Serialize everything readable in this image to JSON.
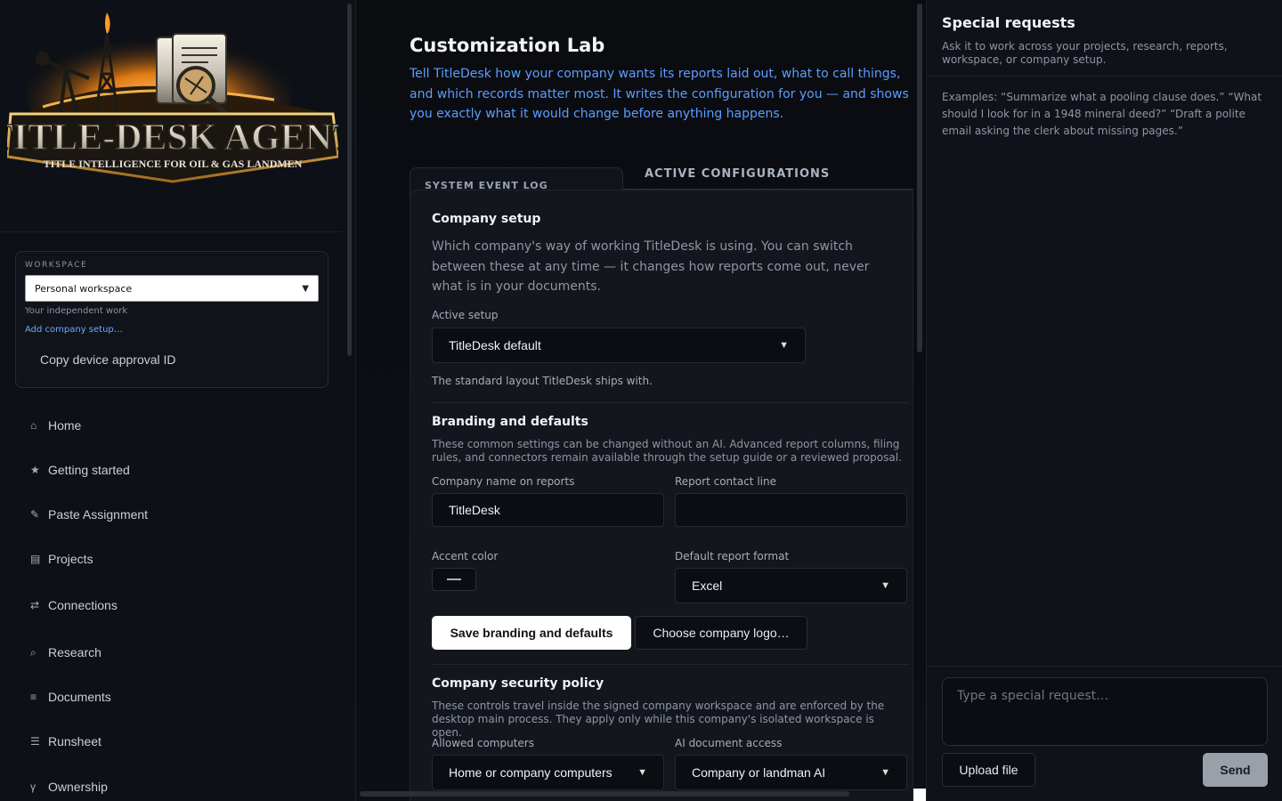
{
  "logo": {
    "title": "TITLE-DESK AGENT",
    "tagline": "TITLE INTELLIGENCE FOR OIL & GAS LANDMEN"
  },
  "workspace": {
    "label": "WORKSPACE",
    "selected": "Personal workspace",
    "subtext": "Your independent work",
    "add_link": "Add company setup…",
    "copy_button": "Copy device approval ID"
  },
  "nav": [
    {
      "label": "Home",
      "icon": "home-icon",
      "glyph": "⌂"
    },
    {
      "label": "Getting started",
      "icon": "star-icon",
      "glyph": "★"
    },
    {
      "label": "Paste Assignment",
      "icon": "pencil-icon",
      "glyph": "✎"
    },
    {
      "label": "Projects",
      "icon": "projects-icon",
      "glyph": "▤"
    },
    {
      "label": "Connections",
      "icon": "arrows-icon",
      "glyph": "⇄"
    },
    {
      "label": "Research",
      "icon": "search-icon",
      "glyph": "⌕"
    },
    {
      "label": "Documents",
      "icon": "documents-icon",
      "glyph": "≡"
    },
    {
      "label": "Runsheet",
      "icon": "list-icon",
      "glyph": "☰"
    },
    {
      "label": "Ownership",
      "icon": "branch-icon",
      "glyph": "γ"
    }
  ],
  "main": {
    "title": "Customization Lab",
    "description": "Tell TitleDesk how your company wants its reports laid out, what to call things, and which records matter most. It writes the configuration for you — and shows you exactly what it would change before anything happens.",
    "tabs": {
      "log": "SYSTEM EVENT LOG",
      "active": "ACTIVE CONFIGURATIONS"
    },
    "company_setup": {
      "title": "Company setup",
      "description": "Which company's way of working TitleDesk is using. You can switch between these at any time — it changes how reports come out, never what is in your documents.",
      "active_label": "Active setup",
      "active_value": "TitleDesk default",
      "active_note": "The standard layout TitleDesk ships with."
    },
    "branding": {
      "title": "Branding and defaults",
      "description": "These common settings can be changed without an AI. Advanced report columns, filing rules, and connectors remain available through the setup guide or a reviewed proposal.",
      "company_name_label": "Company name on reports",
      "company_name_value": "TitleDesk",
      "contact_label": "Report contact line",
      "contact_value": "",
      "accent_label": "Accent color",
      "format_label": "Default report format",
      "format_value": "Excel",
      "save_button": "Save branding and defaults",
      "logo_button": "Choose company logo…"
    },
    "security": {
      "title": "Company security policy",
      "description": "These controls travel inside the signed company workspace and are enforced by the desktop main process. They apply only while this company's isolated workspace is open.",
      "computers_label": "Allowed computers",
      "computers_value": "Home or company computers",
      "ai_label": "AI document access",
      "ai_value": "Company or landman AI"
    }
  },
  "right": {
    "title": "Special requests",
    "subtitle": "Ask it to work across your projects, research, reports, workspace, or company setup.",
    "examples": "Examples: “Summarize what a pooling clause does.” “What should I look for in a 1948 mineral deed?” “Draft a polite email asking the clerk about missing pages.”",
    "placeholder": "Type a special request…",
    "upload": "Upload file",
    "send": "Send"
  }
}
